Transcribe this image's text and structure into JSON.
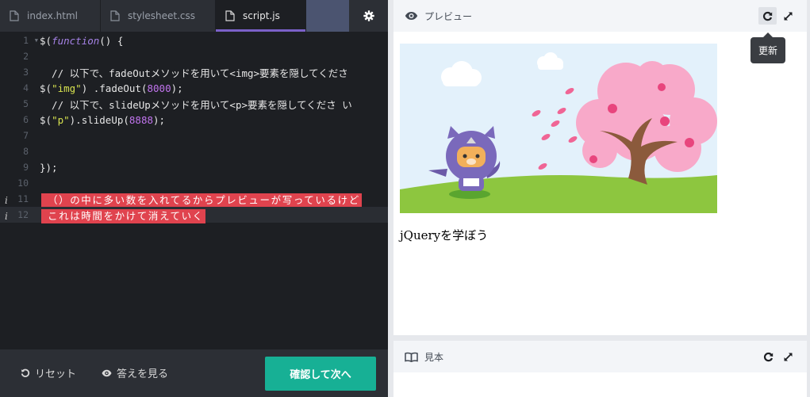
{
  "editor": {
    "tabs": [
      {
        "label": "index.html",
        "icon": "file-icon",
        "active": false
      },
      {
        "label": "stylesheet.css",
        "icon": "file-icon",
        "active": false
      },
      {
        "label": "script.js",
        "icon": "file-icon",
        "active": true
      }
    ],
    "settings_icon": "gear-icon",
    "lines": [
      {
        "number": "1",
        "has_info": false,
        "text": "$(function() {"
      },
      {
        "number": "2",
        "has_info": false,
        "text": ""
      },
      {
        "number": "3",
        "has_info": false,
        "text": "  // 以下で、fadeOutメソッドを用いて<img>要素を隠してくださ"
      },
      {
        "number": "4",
        "has_info": false,
        "text": "$(\"img\") .fadeOut(8000);"
      },
      {
        "number": "5",
        "has_info": false,
        "text": "  // 以下で、slideUpメソッドを用いて<p>要素を隠してくださ い"
      },
      {
        "number": "6",
        "has_info": false,
        "text": "$(\"p\").slideUp(8888);"
      },
      {
        "number": "7",
        "has_info": false,
        "text": ""
      },
      {
        "number": "8",
        "has_info": false,
        "text": ""
      },
      {
        "number": "9",
        "has_info": false,
        "text": "});"
      },
      {
        "number": "10",
        "has_info": false,
        "text": ""
      },
      {
        "number": "11",
        "has_info": true,
        "text": "（）の中に多い数を入れてるからプレビューが写っているけど"
      },
      {
        "number": "12",
        "has_info": true,
        "text": "これは時間をかけて消えていく"
      }
    ],
    "info_marker": "i"
  },
  "footer": {
    "reset_label": "リセット",
    "answer_label": "答えを見る",
    "next_label": "確認して次へ"
  },
  "preview": {
    "title": "プレビュー",
    "tooltip": "更新",
    "text": "jQueryを学ぼう",
    "colors": {
      "accent": "#17b095",
      "error": "#e0434e",
      "tab_underline": "#7b61c9"
    }
  },
  "sample": {
    "title": "見本"
  }
}
